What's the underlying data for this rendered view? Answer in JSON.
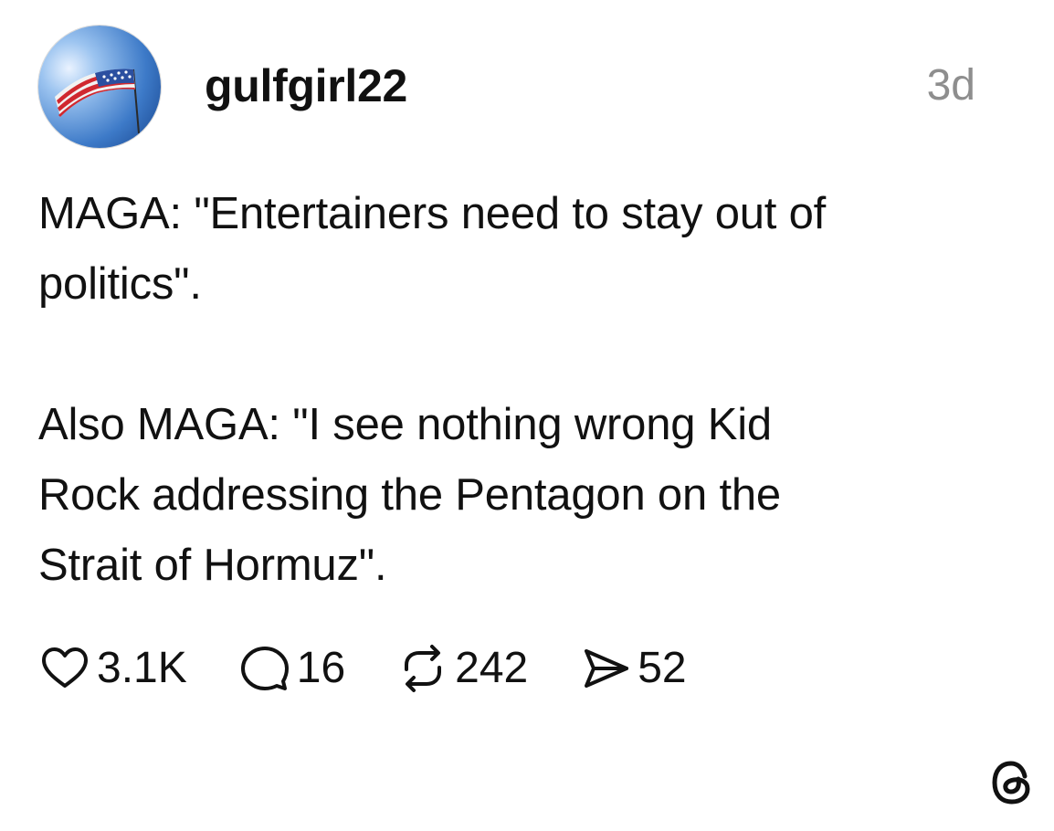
{
  "post": {
    "author": {
      "username": "gulfgirl22",
      "avatar_icon": "flag-avatar-icon"
    },
    "timestamp": "3d",
    "body": {
      "paragraph_1": "MAGA: \"Entertainers need to stay out of\npolitics\".",
      "paragraph_2": "Also MAGA: \"I see nothing wrong Kid\nRock addressing the Pentagon on the\nStrait of Hormuz\"."
    },
    "actions": {
      "likes": "3.1K",
      "replies": "16",
      "reposts": "242",
      "shares": "52"
    }
  },
  "branding": {
    "logo_icon": "threads-logo-icon"
  },
  "colors": {
    "text": "#111111",
    "muted": "#8e8e8e",
    "background": "#ffffff"
  }
}
